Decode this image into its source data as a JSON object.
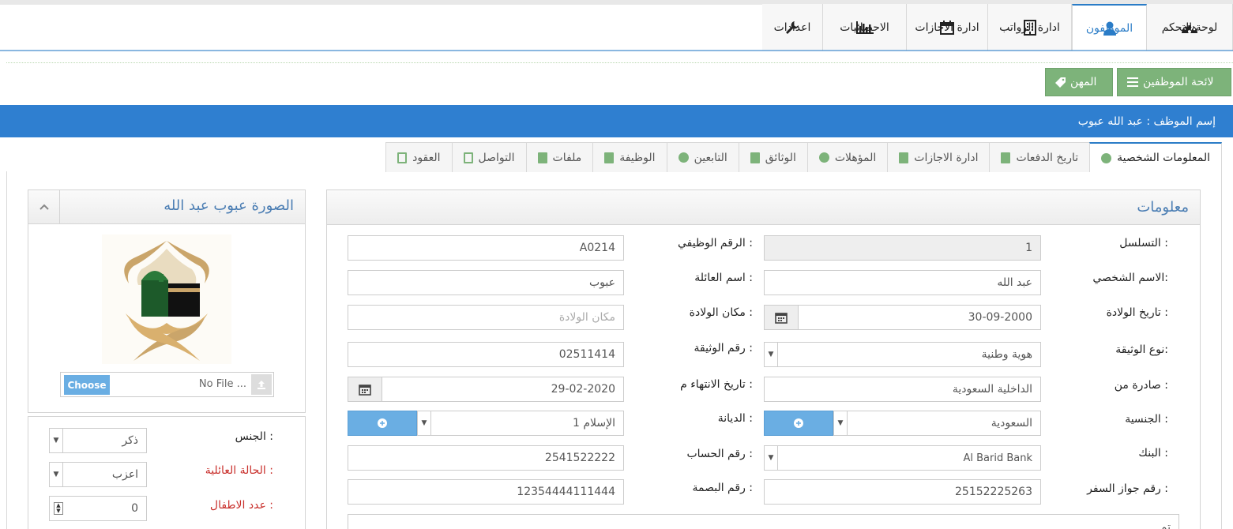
{
  "nav": {
    "items": [
      {
        "label": "لوحة التحكم",
        "icon": "dashboard-icon"
      },
      {
        "label": "الموظفون",
        "icon": "user-icon",
        "active": true
      },
      {
        "label": "ادارة الرواتب",
        "icon": "building-icon"
      },
      {
        "label": "ادارة الاجازات",
        "icon": "calendar-icon"
      },
      {
        "label": "الاحصائيات",
        "icon": "bar-chart-icon"
      },
      {
        "label": "اعدادات",
        "icon": "wrench-icon"
      }
    ]
  },
  "actions": {
    "employees_list": "لائحة الموظفين",
    "jobs": "المهن"
  },
  "banner": {
    "employee_name": "إسم الموظف : عبد الله عبوب"
  },
  "tabs": [
    "المعلومات الشخصية",
    "تاريخ الدفعات",
    "ادارة الاجازات",
    "المؤهلات",
    "الوثائق",
    "التابعين",
    "الوظيفة",
    "ملفات",
    "التواصل",
    "العقود"
  ],
  "info": {
    "title": "معلومات",
    "serial_label": "التسلسل :",
    "serial_value": "1",
    "job_no_label": "الرقم الوظيفي :",
    "job_no_value": "A0214",
    "first_name_label": "الاسم الشخصي:",
    "first_name_value": "عبد الله",
    "family_name_label": "اسم العائلة :",
    "family_name_value": "عبوب",
    "birth_date_label": "تاريخ الولادة :",
    "birth_date_value": "30-09-2000",
    "birth_place_label": "مكان الولادة :",
    "birth_place_placeholder": "مكان الولادة",
    "doc_type_label": "نوع الوثيقة:",
    "doc_type_value": "هوية وطنية",
    "doc_no_label": "رقم الوثيقة :",
    "doc_no_value": "02511414",
    "issued_from_label": "صادرة من :",
    "issued_from_value": "الداخلية السعودية",
    "expiry_label": "تاريخ الانتهاء م :",
    "expiry_value": "29-02-2020",
    "nationality_label": "الجنسية :",
    "nationality_value": "السعودية",
    "religion_label": "الديانة :",
    "religion_value": "الإسلام 1",
    "bank_label": "البنك :",
    "bank_value": "Al Barid Bank",
    "account_label": "رقم الحساب :",
    "account_value": "2541522222",
    "passport_label": "رقم جواز السفر :",
    "passport_value": "25152225263",
    "fingerprint_label": "رقم البصمة :",
    "fingerprint_value": "12354444111444",
    "partial_text": "تم"
  },
  "photo": {
    "title": "الصورة عبوب عبد الله",
    "choose": "Choose",
    "no_file": "No File ..."
  },
  "side": {
    "gender_label": "الجنس :",
    "gender_value": "ذكر",
    "marital_label": "الحالة العائلية :",
    "marital_value": "اعزب",
    "children_label": "عدد الاطفال :",
    "children_value": "0"
  },
  "colors": {
    "accent": "#2a7cc7",
    "banner": "#2f7fd0",
    "green": "#7db37a",
    "label_red": "#c9302c"
  }
}
